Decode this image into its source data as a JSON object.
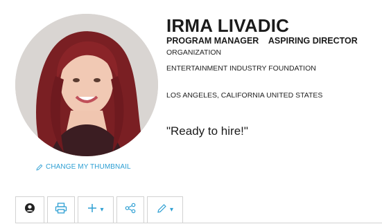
{
  "profile": {
    "name": "IRMA LIVADIC",
    "titles": [
      "PROGRAM MANAGER",
      "ASPIRING DIRECTOR"
    ],
    "organization_label": "ORGANIZATION",
    "organization_name": "ENTERTAINMENT INDUSTRY FOUNDATION",
    "location": "LOS ANGELES, CALIFORNIA UNITED STATES",
    "quote": "\"Ready to hire!\""
  },
  "avatar": {
    "change_thumbnail_label": "CHANGE MY THUMBNAIL",
    "icon": "pencil-icon"
  },
  "toolbar": {
    "buttons": [
      {
        "icon": "user-circle-icon",
        "active": true
      },
      {
        "icon": "printer-icon"
      },
      {
        "icon": "plus-icon",
        "dropdown": true
      },
      {
        "icon": "share-icon"
      },
      {
        "icon": "pencil-icon",
        "dropdown": true
      }
    ]
  },
  "colors": {
    "accent": "#2d9fd3",
    "text": "#1b1b1b",
    "border": "#d2d2d2"
  }
}
